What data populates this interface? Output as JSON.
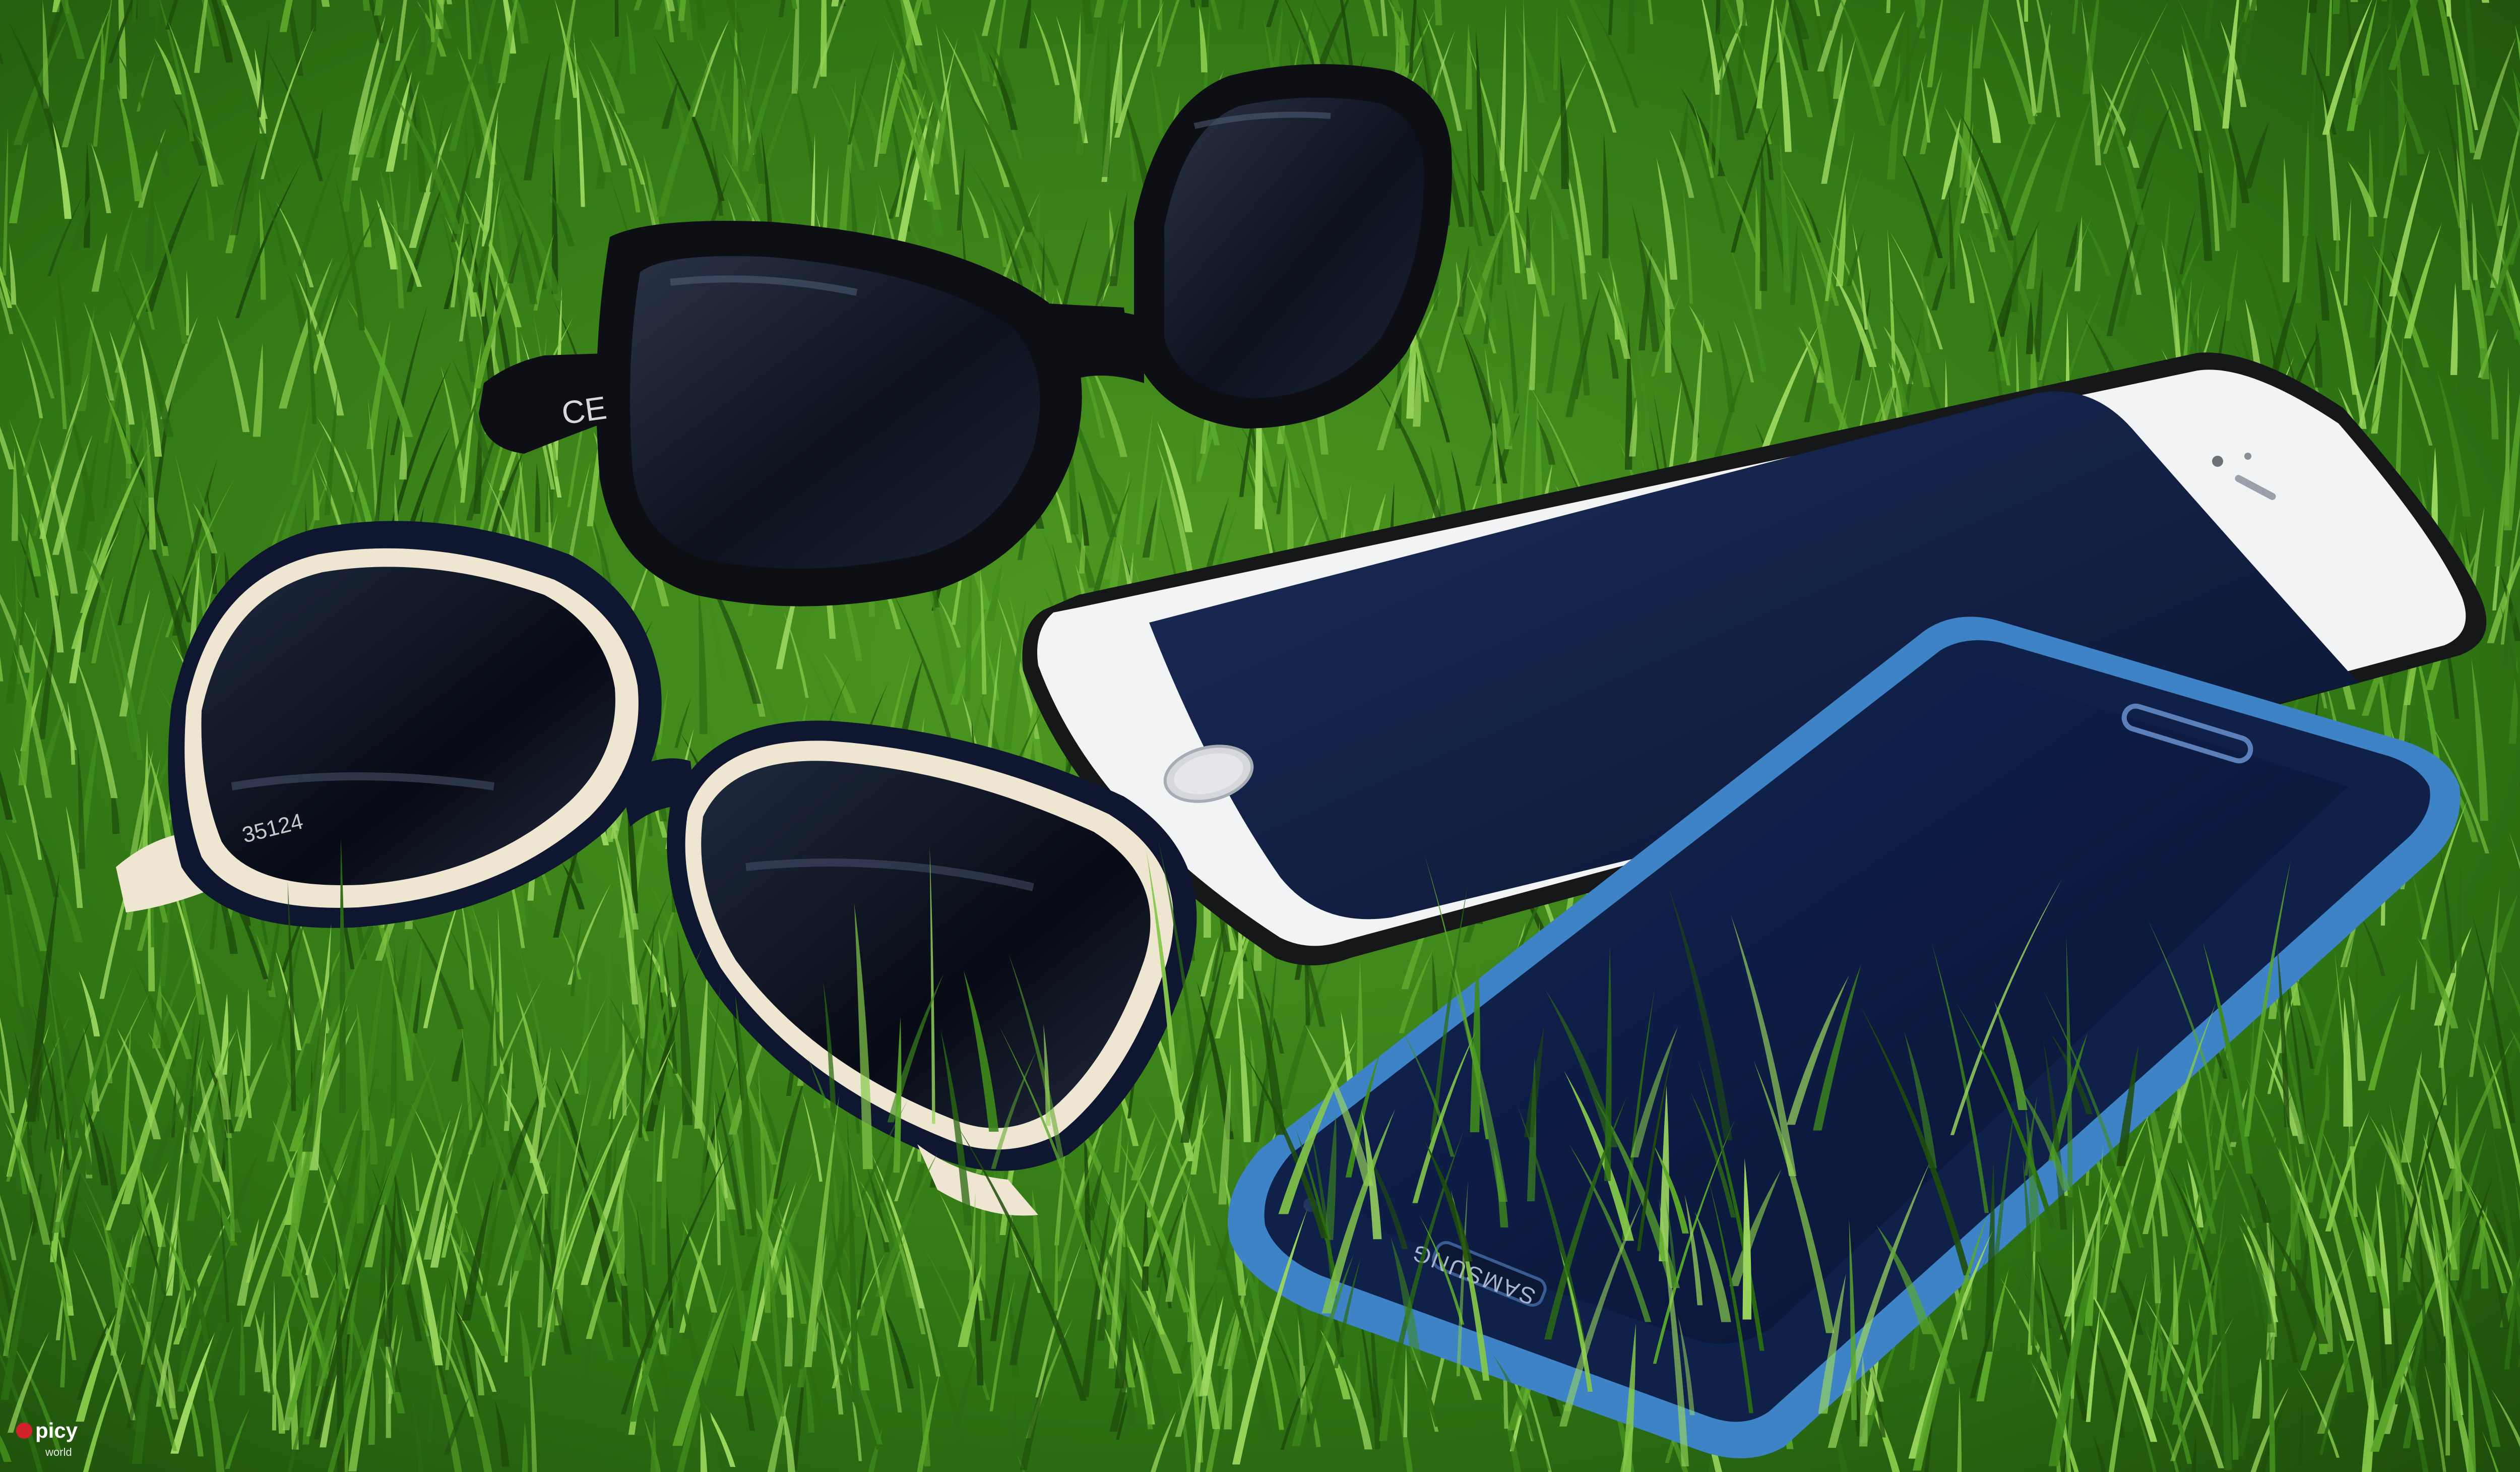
{
  "scene": {
    "subject": "sunglasses-and-smartphones-on-grass",
    "colors": {
      "grass_dark": "#1f4d0c",
      "grass_mid": "#3f8a1c",
      "grass_light": "#86c94a",
      "frame_black": "#0d0f14",
      "frame_navy": "#0e1630",
      "frame_cream": "#efe6d2",
      "iphone_white": "#f2f3f5",
      "screen_dark": "#0c1838",
      "samsung_blue": "#3d83c6",
      "samsung_screen": "#0b1a3e"
    }
  },
  "texts": {
    "ce_mark": "CE",
    "lens_code": "35124",
    "samsung_brand": "SAMSUNG",
    "watermark_main": "picy",
    "watermark_sub": "world"
  }
}
